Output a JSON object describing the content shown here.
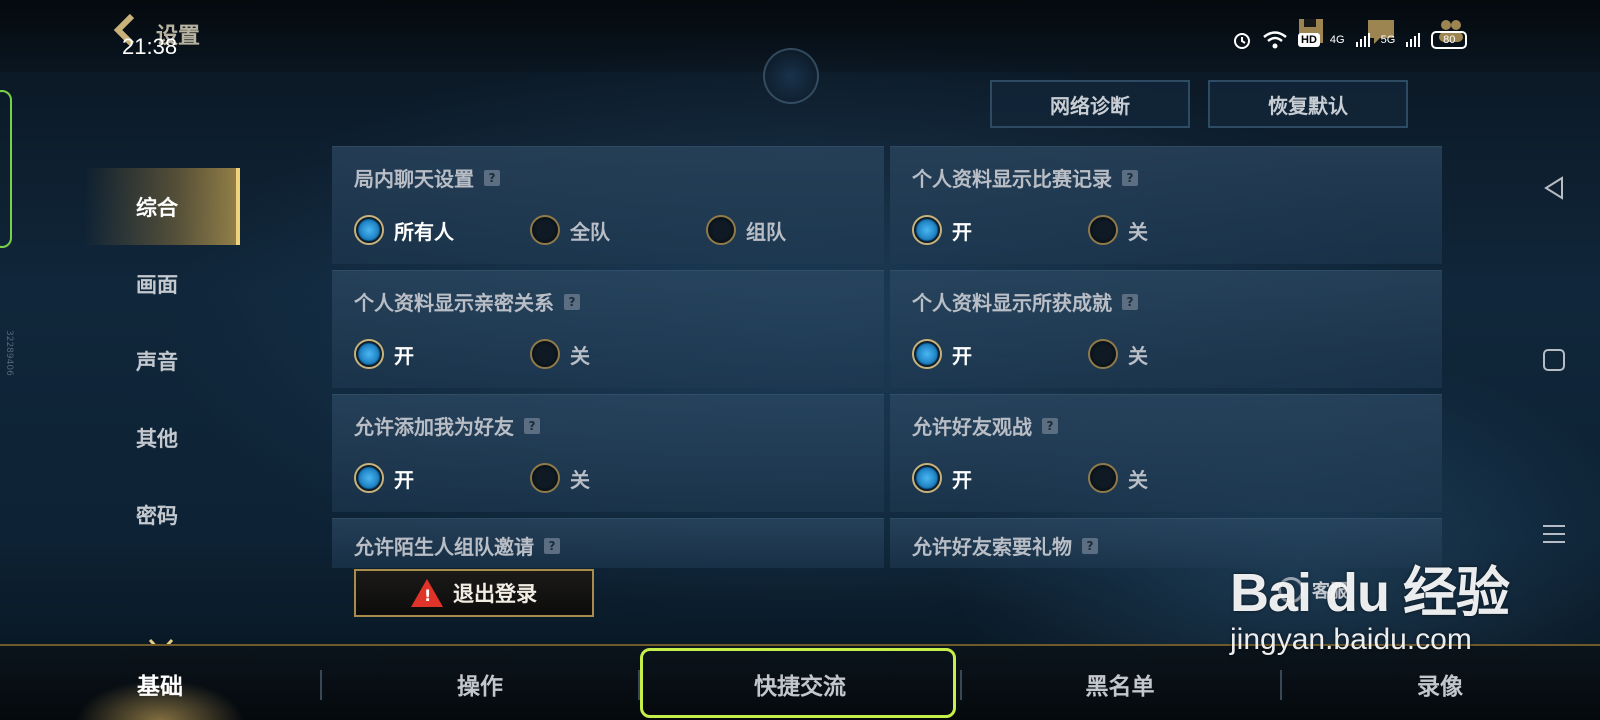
{
  "status": {
    "back_title": "设置",
    "time": "21:38",
    "network_4g": "4G",
    "network_5g": "5G",
    "battery": "80",
    "hd_label": "HD"
  },
  "side_nav": {
    "items": [
      {
        "label": "综合"
      },
      {
        "label": "画面"
      },
      {
        "label": "声音"
      },
      {
        "label": "其他"
      },
      {
        "label": "密码"
      }
    ],
    "active_index": 0
  },
  "side_vertical_text": "32289406",
  "top_buttons": {
    "network_diag": "网络诊断",
    "restore_default": "恢复默认"
  },
  "help_glyph": "?",
  "settings": {
    "chat": {
      "title": "局内聊天设置",
      "options": [
        "所有人",
        "全队",
        "组队"
      ],
      "selected": 0
    },
    "match_record": {
      "title": "个人资料显示比赛记录",
      "options": [
        "开",
        "关"
      ],
      "selected": 0
    },
    "intimacy": {
      "title": "个人资料显示亲密关系",
      "options": [
        "开",
        "关"
      ],
      "selected": 0
    },
    "achievement": {
      "title": "个人资料显示所获成就",
      "options": [
        "开",
        "关"
      ],
      "selected": 0
    },
    "add_friend": {
      "title": "允许添加我为好友",
      "options": [
        "开",
        "关"
      ],
      "selected": 0
    },
    "spectate": {
      "title": "允许好友观战",
      "options": [
        "开",
        "关"
      ],
      "selected": 0
    },
    "stranger_invite": {
      "title": "允许陌生人组队邀请"
    },
    "gift_request": {
      "title": "允许好友索要礼物"
    }
  },
  "logout_label": "退出登录",
  "customer_service": "客服",
  "bottom_tabs": {
    "items": [
      {
        "label": "基础"
      },
      {
        "label": "操作"
      },
      {
        "label": "快捷交流"
      },
      {
        "label": "黑名单"
      },
      {
        "label": "录像"
      }
    ],
    "active_index": 0,
    "highlighted_index": 2
  },
  "watermark": {
    "logo": "Bai du 经验",
    "url": "jingyan.baidu.com"
  },
  "colors": {
    "accent_gold": "#f0d27a",
    "radio_on": "#4bb6f0",
    "highlight_green": "#c6ef4a",
    "warning_red": "#e0342a"
  }
}
